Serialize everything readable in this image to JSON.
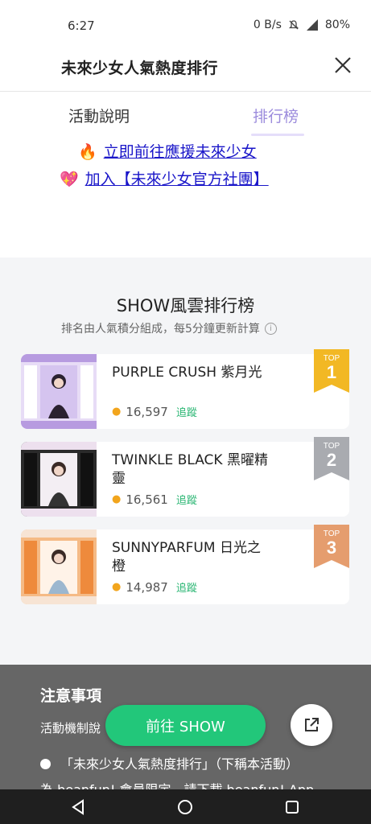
{
  "status_bar": {
    "time": "6:27",
    "network_speed": "0 B/s",
    "battery": "80%"
  },
  "header": {
    "title": "未來少女人氣熱度排行",
    "close_icon": "close-icon"
  },
  "tabs": [
    {
      "label": "活動說明",
      "active": false
    },
    {
      "label": "排行榜",
      "active": true
    }
  ],
  "promo": {
    "link1": {
      "emoji": "🔥",
      "text": "立即前往應援未來少女"
    },
    "link2": {
      "emoji": "💖",
      "text": "加入【未來少女官方社團】"
    }
  },
  "ranking": {
    "title": "SHOW風雲排行榜",
    "subtitle": "排名由人氣積分組成，每5分鐘更新計算",
    "entries": [
      {
        "rank": "1",
        "badge_label": "TOP",
        "name": "PURPLE CRUSH 紫月光",
        "score": "16,597",
        "follow": "追蹤",
        "badge_color": "#f2b824"
      },
      {
        "rank": "2",
        "badge_label": "TOP",
        "name": "TWINKLE BLACK 黑曜精靈",
        "score": "16,561",
        "follow": "追蹤",
        "badge_color": "#a9abb0"
      },
      {
        "rank": "3",
        "badge_label": "TOP",
        "name": "SUNNYPARFUM 日光之橙",
        "score": "14,987",
        "follow": "追蹤",
        "badge_color": "#e59d6e"
      }
    ]
  },
  "notice": {
    "title": "注意事項",
    "line1": "活動機制說",
    "line2": "「未來少女人氣熱度排行」（下稱本活動）",
    "line3": "為 beanfun! 會員限定，請下載 beanfun! App"
  },
  "actions": {
    "go_show": "前往 SHOW",
    "share_icon": "external-link-icon"
  },
  "colors": {
    "accent_green": "#22c77a",
    "tab_active": "#9b8bdc",
    "link_blue": "#1a16c9"
  }
}
